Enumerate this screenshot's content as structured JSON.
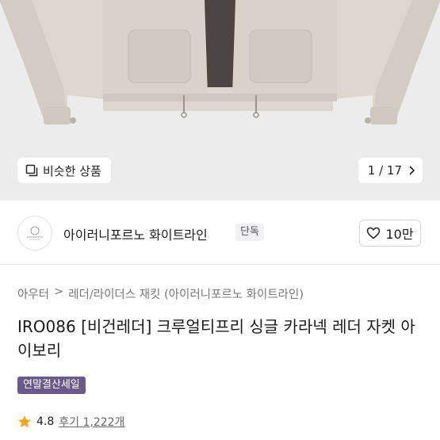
{
  "gallery": {
    "similar_label": "비슷한 상품",
    "counter": "1 / 17"
  },
  "store": {
    "name": "아이러니포르노 화이트라인",
    "badge": "단독",
    "likes": "10만"
  },
  "breadcrumb": {
    "category1": "아우터",
    "separator": ">",
    "category2": "레더/라이더스 재킷 (아이러니포르노 화이트라인)"
  },
  "product": {
    "title": "IRO086 [비건레더] 크루얼티프리 싱글 카라넥 레더 자켓 아이보리",
    "sale_tag": "연말결산세일",
    "rating": "4.8",
    "reviews": "후기 1,222개"
  },
  "colors": {
    "accent_tag": "#6a5a8c",
    "star": "#f5a623"
  }
}
